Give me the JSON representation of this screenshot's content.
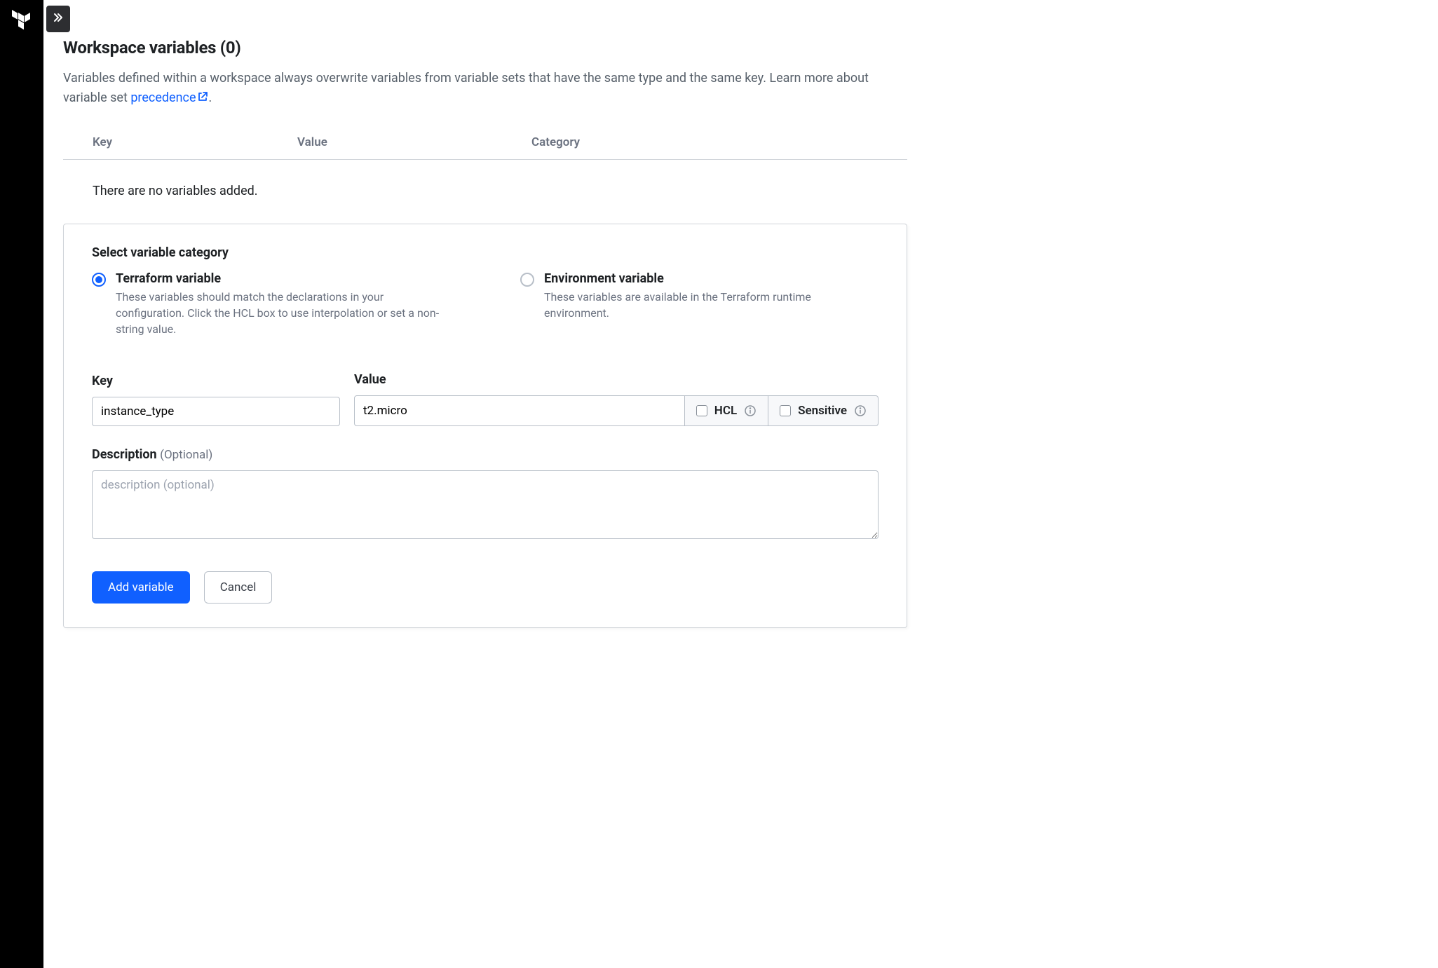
{
  "page": {
    "title": "Workspace variables (0)",
    "intro_prefix": "Variables defined within a workspace always overwrite variables from variable sets that have the same type and the same key. Learn more about variable set ",
    "intro_link": "precedence",
    "intro_suffix": "."
  },
  "table": {
    "headers": {
      "key": "Key",
      "value": "Value",
      "category": "Category"
    },
    "empty": "There are no variables added."
  },
  "form": {
    "section_title": "Select variable category",
    "options": {
      "terraform": {
        "label": "Terraform variable",
        "desc": "These variables should match the declarations in your configuration. Click the HCL box to use interpolation or set a non-string value."
      },
      "environment": {
        "label": "Environment variable",
        "desc": "These variables are available in the Terraform runtime environment."
      }
    },
    "fields": {
      "key_label": "Key",
      "key_value": "instance_type",
      "value_label": "Value",
      "value_value": "t2.micro",
      "hcl_label": "HCL",
      "sensitive_label": "Sensitive",
      "desc_label": "Description",
      "desc_optional": "(Optional)",
      "desc_placeholder": "description (optional)"
    },
    "actions": {
      "add": "Add variable",
      "cancel": "Cancel"
    }
  }
}
